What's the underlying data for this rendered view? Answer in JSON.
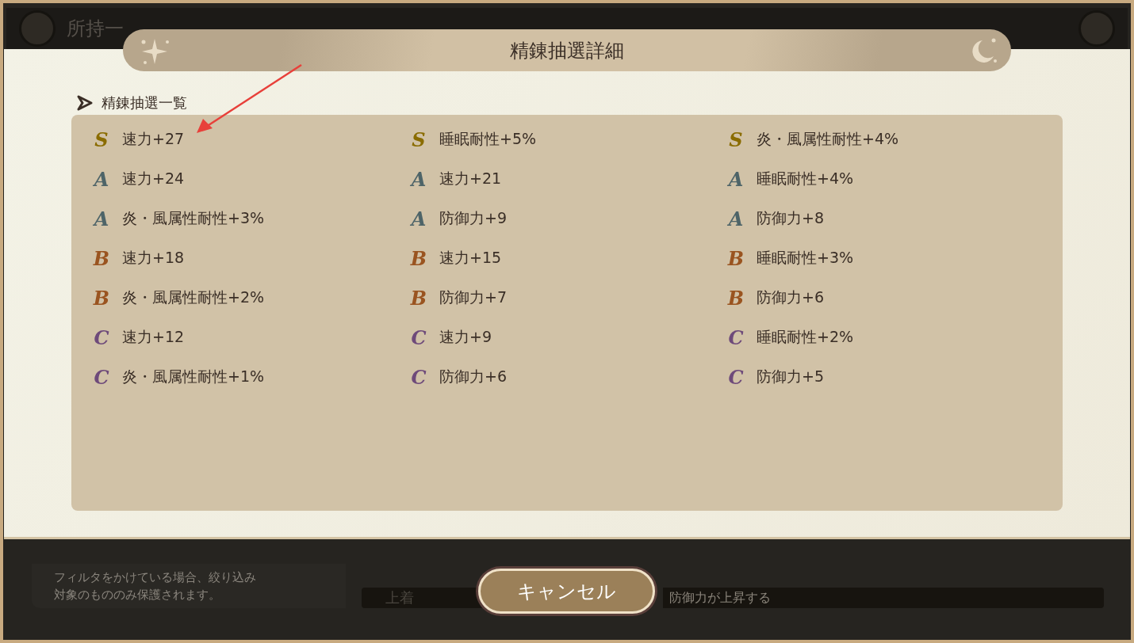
{
  "background": {
    "screen_title": "所持一",
    "notice": [
      "フィルタをかけている場合、絞り込み",
      "対象のもののみ保護されます。"
    ],
    "row": {
      "slot": "上着",
      "effect": "防御力が上昇する"
    }
  },
  "dialog": {
    "title": "精錬抽選詳細",
    "section_label": "精錬抽選一覧",
    "columns": [
      [
        {
          "rank": "S",
          "color": "#8a6c00",
          "text": "速力+27"
        },
        {
          "rank": "A",
          "color": "#4e6468",
          "text": "速力+24"
        },
        {
          "rank": "A",
          "color": "#4e6468",
          "text": "炎・風属性耐性+3%"
        },
        {
          "rank": "B",
          "color": "#9a5420",
          "text": "速力+18"
        },
        {
          "rank": "B",
          "color": "#9a5420",
          "text": "炎・風属性耐性+2%"
        },
        {
          "rank": "C",
          "color": "#6e4a7a",
          "text": "速力+12"
        },
        {
          "rank": "C",
          "color": "#6e4a7a",
          "text": "炎・風属性耐性+1%"
        }
      ],
      [
        {
          "rank": "S",
          "color": "#8a6c00",
          "text": "睡眠耐性+5%"
        },
        {
          "rank": "A",
          "color": "#4e6468",
          "text": "速力+21"
        },
        {
          "rank": "A",
          "color": "#4e6468",
          "text": "防御力+9"
        },
        {
          "rank": "B",
          "color": "#9a5420",
          "text": "速力+15"
        },
        {
          "rank": "B",
          "color": "#9a5420",
          "text": "防御力+7"
        },
        {
          "rank": "C",
          "color": "#6e4a7a",
          "text": "速力+9"
        },
        {
          "rank": "C",
          "color": "#6e4a7a",
          "text": "防御力+6"
        }
      ],
      [
        {
          "rank": "S",
          "color": "#8a6c00",
          "text": "炎・風属性耐性+4%"
        },
        {
          "rank": "A",
          "color": "#4e6468",
          "text": "睡眠耐性+4%"
        },
        {
          "rank": "A",
          "color": "#4e6468",
          "text": "防御力+8"
        },
        {
          "rank": "B",
          "color": "#9a5420",
          "text": "睡眠耐性+3%"
        },
        {
          "rank": "B",
          "color": "#9a5420",
          "text": "防御力+6"
        },
        {
          "rank": "C",
          "color": "#6e4a7a",
          "text": "睡眠耐性+2%"
        },
        {
          "rank": "C",
          "color": "#6e4a7a",
          "text": "防御力+5"
        }
      ]
    ]
  },
  "cancel_button": "キャンセル"
}
